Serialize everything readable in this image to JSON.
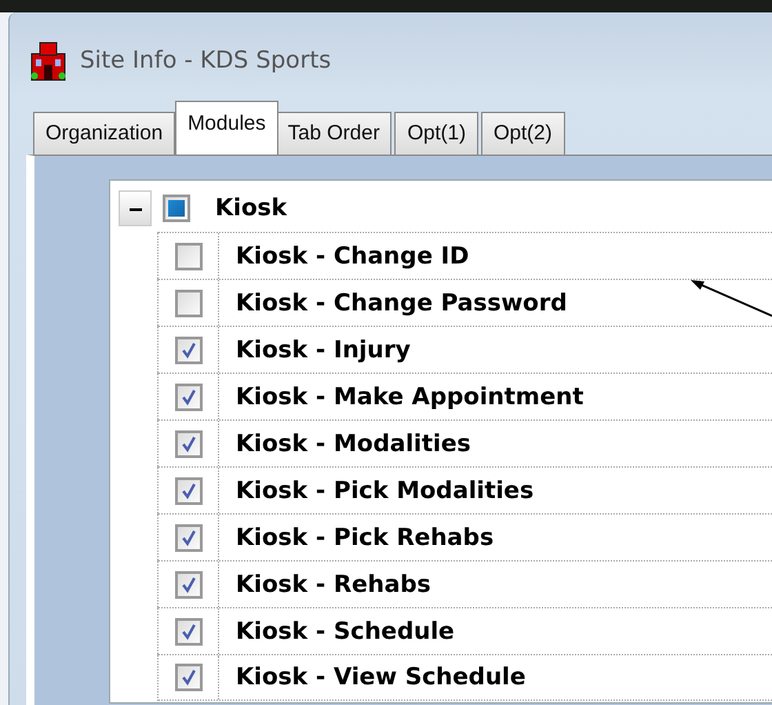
{
  "window": {
    "title": "Site Info - KDS Sports"
  },
  "tabs": [
    {
      "label": "Organization",
      "selected": false
    },
    {
      "label": "Modules",
      "selected": true
    },
    {
      "label": "Tab Order",
      "selected": false
    },
    {
      "label": "Opt(1)",
      "selected": false
    },
    {
      "label": "Opt(2)",
      "selected": false
    }
  ],
  "tree": [
    {
      "label": "Kiosk",
      "expanded": true,
      "partial": true,
      "children": [
        {
          "label": "Kiosk - Change ID",
          "checked": false
        },
        {
          "label": "Kiosk - Change Password",
          "checked": false
        },
        {
          "label": "Kiosk - Injury",
          "checked": true
        },
        {
          "label": "Kiosk - Make Appointment",
          "checked": true
        },
        {
          "label": "Kiosk - Modalities",
          "checked": true
        },
        {
          "label": "Kiosk - Pick Modalities",
          "checked": true
        },
        {
          "label": "Kiosk - Pick Rehabs",
          "checked": true
        },
        {
          "label": "Kiosk - Rehabs",
          "checked": true
        },
        {
          "label": "Kiosk - Schedule",
          "checked": true
        },
        {
          "label": "Kiosk - View Schedule",
          "checked": true
        }
      ]
    }
  ]
}
